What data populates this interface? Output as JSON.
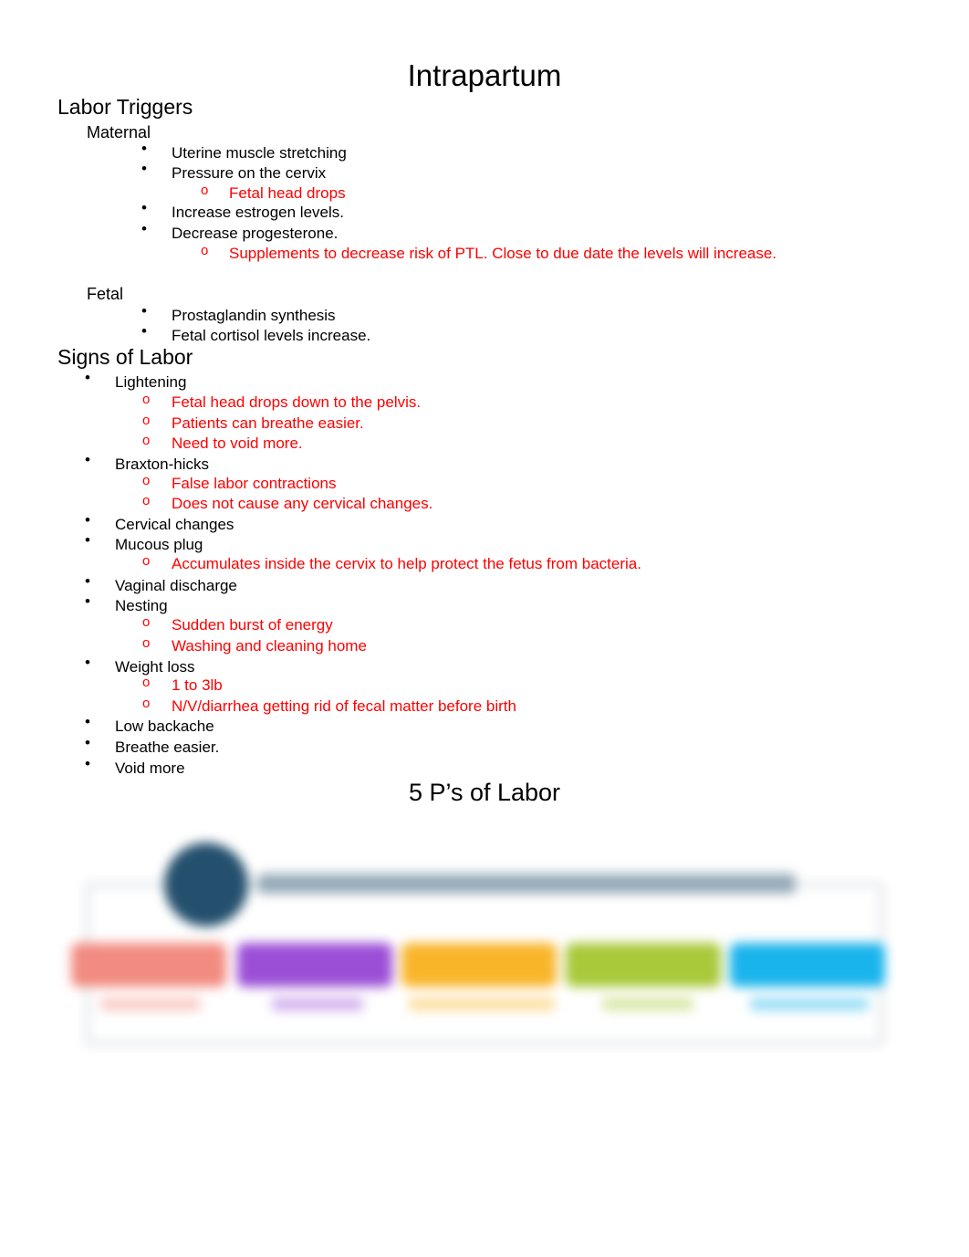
{
  "document": {
    "title": "Intrapartum",
    "sections": {
      "labor_triggers": {
        "heading": "Labor Triggers",
        "maternal": {
          "heading": "Maternal",
          "items": [
            {
              "text": "Uterine muscle stretching"
            },
            {
              "text": "Pressure on the cervix",
              "notes": [
                "Fetal head drops"
              ]
            },
            {
              "text": "Increase estrogen levels."
            },
            {
              "text": "Decrease progesterone.",
              "notes": [
                "Supplements to decrease risk of PTL. Close to due date the levels will increase."
              ]
            }
          ]
        },
        "fetal": {
          "heading": "Fetal",
          "items": [
            {
              "text": "Prostaglandin synthesis"
            },
            {
              "text": "Fetal cortisol levels increase."
            }
          ]
        }
      },
      "signs_of_labor": {
        "heading": "Signs of Labor",
        "items": [
          {
            "text": "Lightening",
            "notes": [
              "Fetal head drops down to the pelvis.",
              "Patients can breathe easier.",
              "Need to void more."
            ]
          },
          {
            "text": "Braxton-hicks",
            "notes": [
              "False labor contractions",
              "Does not cause any cervical changes."
            ]
          },
          {
            "text": "Cervical changes"
          },
          {
            "text": "Mucous plug",
            "notes": [
              "Accumulates inside the cervix to help protect the fetus from bacteria."
            ]
          },
          {
            "text": "Vaginal discharge"
          },
          {
            "text": "Nesting",
            "notes": [
              "Sudden burst of energy",
              "Washing and cleaning home"
            ]
          },
          {
            "text": "Weight loss",
            "notes": [
              "1 to 3lb",
              "N/V/diarrhea getting rid of fecal matter before birth"
            ]
          },
          {
            "text": "Low backache"
          },
          {
            "text": "Breathe easier."
          },
          {
            "text": "Void more"
          }
        ]
      },
      "five_ps": {
        "heading": "5 P’s of Labor",
        "figure": {
          "blurred": true,
          "colors": {
            "logo": "#24506e",
            "boxes": [
              "#f28b80",
              "#9b4fd6",
              "#f9b52a",
              "#a8c93a",
              "#1ab4ec"
            ]
          }
        }
      }
    },
    "bullet_glyph": "•",
    "subbullet_glyph": "o",
    "note_color": "#ff0000"
  }
}
